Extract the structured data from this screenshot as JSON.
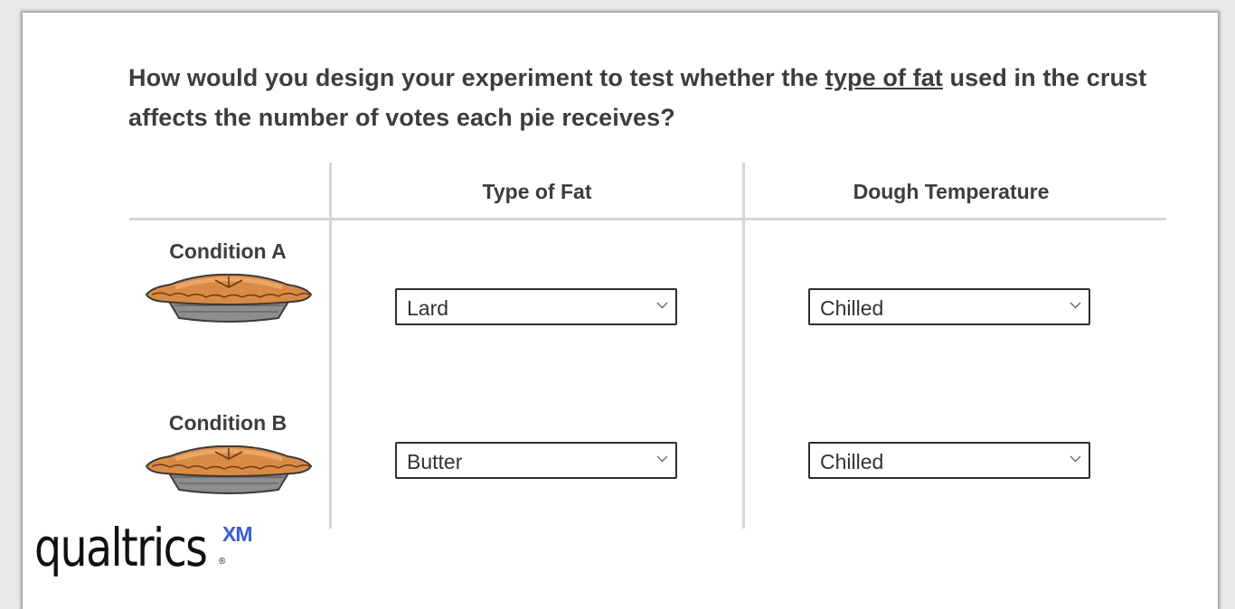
{
  "question": {
    "before": "How would you design your experiment to test whether the ",
    "underlined": "type of fat",
    "after": " used in the crust affects the number of votes each pie receives?"
  },
  "table": {
    "columns": [
      "Type of Fat",
      "Dough Temperature"
    ],
    "rows": [
      {
        "label": "Condition A",
        "fat": "Lard",
        "temperature": "Chilled"
      },
      {
        "label": "Condition B",
        "fat": "Butter",
        "temperature": "Chilled"
      }
    ]
  },
  "logo": {
    "word": "qualtrics",
    "sup": "XM",
    "reg": "®"
  },
  "colors": {
    "text": "#3d3d3d",
    "grid": "#d5d5d5",
    "logo_accent": "#3b5bdb"
  },
  "icons": {
    "pie": "pie-icon",
    "dropdown": "chevron-down-icon"
  }
}
